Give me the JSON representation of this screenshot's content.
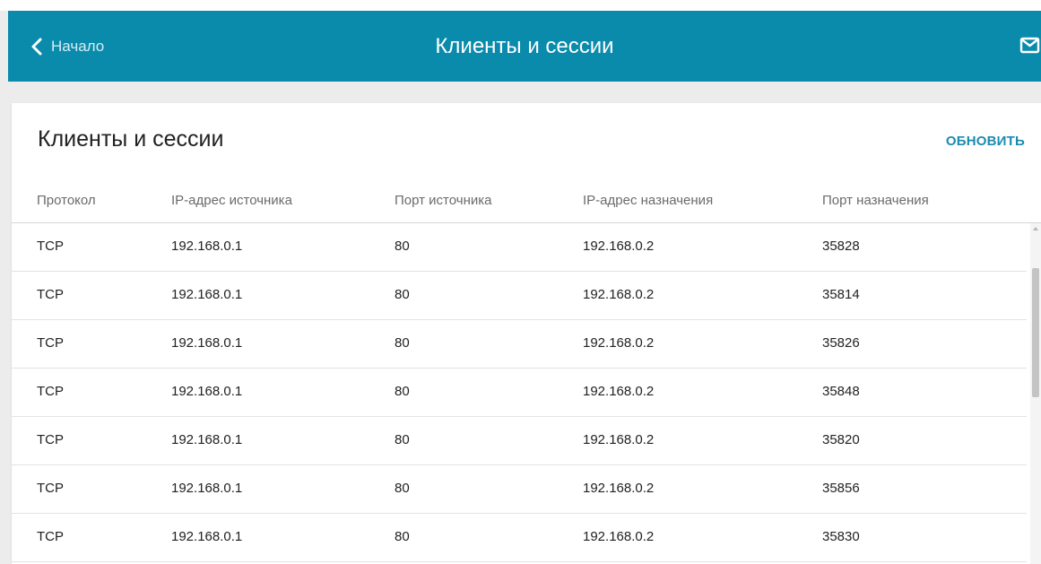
{
  "header": {
    "back_label": "Начало",
    "title": "Клиенты и сессии",
    "mail_icon": "mail-icon",
    "back_icon": "chevron-left-icon",
    "color": "#0b8bab"
  },
  "card": {
    "title": "Клиенты и сессии",
    "refresh_label": "ОБНОВИТЬ",
    "accent_color": "#1a8bb0"
  },
  "table": {
    "columns": [
      "Протокол",
      "IP-адрес источника",
      "Порт источника",
      "IP-адрес назначения",
      "Порт назначения"
    ],
    "rows": [
      [
        "TCP",
        "192.168.0.1",
        "80",
        "192.168.0.2",
        "35828"
      ],
      [
        "TCP",
        "192.168.0.1",
        "80",
        "192.168.0.2",
        "35814"
      ],
      [
        "TCP",
        "192.168.0.1",
        "80",
        "192.168.0.2",
        "35826"
      ],
      [
        "TCP",
        "192.168.0.1",
        "80",
        "192.168.0.2",
        "35848"
      ],
      [
        "TCP",
        "192.168.0.1",
        "80",
        "192.168.0.2",
        "35820"
      ],
      [
        "TCP",
        "192.168.0.1",
        "80",
        "192.168.0.2",
        "35856"
      ],
      [
        "TCP",
        "192.168.0.1",
        "80",
        "192.168.0.2",
        "35830"
      ]
    ]
  }
}
